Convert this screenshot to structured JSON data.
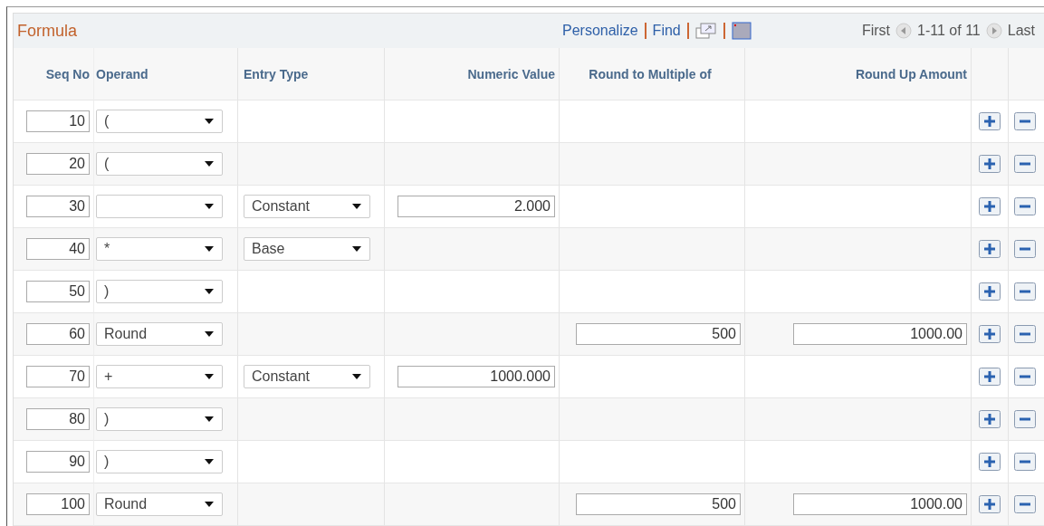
{
  "grid": {
    "title": "Formula",
    "links": [
      "Personalize",
      "Find"
    ],
    "nav": {
      "first": "First",
      "range": "1-11 of 11",
      "last": "Last"
    },
    "columns": [
      "Seq No",
      "Operand",
      "Entry Type",
      "Numeric Value",
      "Round to Multiple of",
      "Round Up Amount"
    ],
    "rows": [
      {
        "seq": "10",
        "operand": "("
      },
      {
        "seq": "20",
        "operand": "("
      },
      {
        "seq": "30",
        "operand": "",
        "entry_type": "Constant",
        "numeric": "2.000"
      },
      {
        "seq": "40",
        "operand": "*",
        "entry_type": "Base"
      },
      {
        "seq": "50",
        "operand": ")"
      },
      {
        "seq": "60",
        "operand": "Round",
        "round_multiple": "500",
        "round_up": "1000.00"
      },
      {
        "seq": "70",
        "operand": "+",
        "entry_type": "Constant",
        "numeric": "1000.000"
      },
      {
        "seq": "80",
        "operand": ")"
      },
      {
        "seq": "90",
        "operand": ")"
      },
      {
        "seq": "100",
        "operand": "Round",
        "round_multiple": "500",
        "round_up": "1000.00"
      }
    ]
  }
}
